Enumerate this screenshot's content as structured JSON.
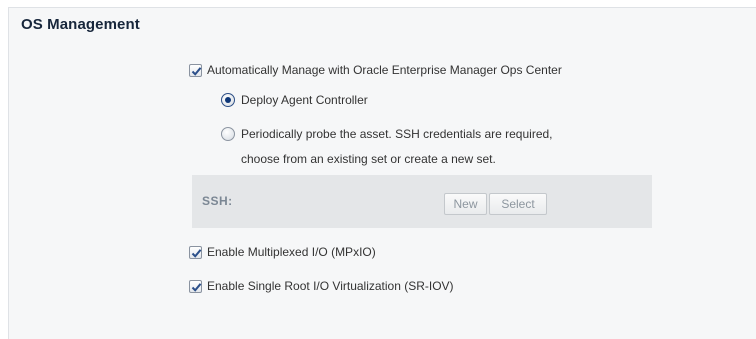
{
  "section": {
    "title": "OS Management"
  },
  "auto_manage": {
    "label": "Automatically Manage with Oracle Enterprise Manager Ops Center",
    "checked": true
  },
  "deploy_agent": {
    "label": "Deploy Agent Controller",
    "selected": true
  },
  "probe": {
    "label_line1": "Periodically probe the asset. SSH credentials are required,",
    "label_line2": "choose from an existing set or create a new set.",
    "selected": false
  },
  "ssh": {
    "label": "SSH:",
    "new_button": "New",
    "select_button": "Select"
  },
  "mpxio": {
    "label": "Enable Multiplexed I/O (MPxIO)",
    "checked": true
  },
  "sriov": {
    "label": "Enable Single Root I/O Virtualization (SR-IOV)",
    "checked": true
  },
  "colors": {
    "title": "#17263b",
    "check": "#2b4f8a",
    "radio_dot": "#0e3778",
    "disabled_text": "#8d969f"
  }
}
